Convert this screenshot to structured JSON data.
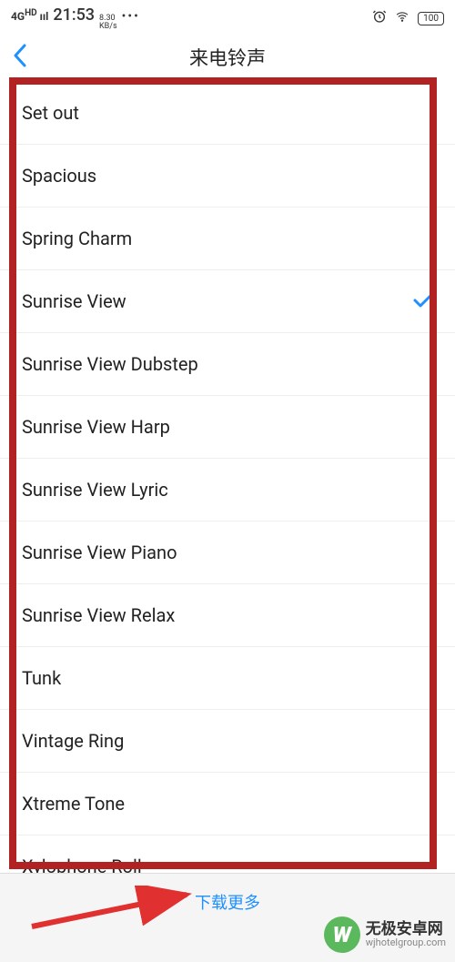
{
  "statusBar": {
    "signal": "4G",
    "time": "21:53",
    "speedValue": "8.30",
    "speedUnit": "KB/s",
    "battery": "100"
  },
  "nav": {
    "title": "来电铃声"
  },
  "ringtones": [
    {
      "name": "Set out",
      "selected": false
    },
    {
      "name": "Spacious",
      "selected": false
    },
    {
      "name": "Spring Charm",
      "selected": false
    },
    {
      "name": "Sunrise View",
      "selected": true
    },
    {
      "name": "Sunrise View Dubstep",
      "selected": false
    },
    {
      "name": "Sunrise View Harp",
      "selected": false
    },
    {
      "name": "Sunrise View Lyric",
      "selected": false
    },
    {
      "name": "Sunrise View Piano",
      "selected": false
    },
    {
      "name": "Sunrise View Relax",
      "selected": false
    },
    {
      "name": "Tunk",
      "selected": false
    },
    {
      "name": "Vintage Ring",
      "selected": false
    },
    {
      "name": "Xtreme Tone",
      "selected": false
    },
    {
      "name": "Xylophone Roll",
      "selected": false
    }
  ],
  "downloadMore": "下载更多",
  "watermark": {
    "logoLetter": "W",
    "title": "无极安卓网",
    "url": "wjhotelgroup.com"
  }
}
